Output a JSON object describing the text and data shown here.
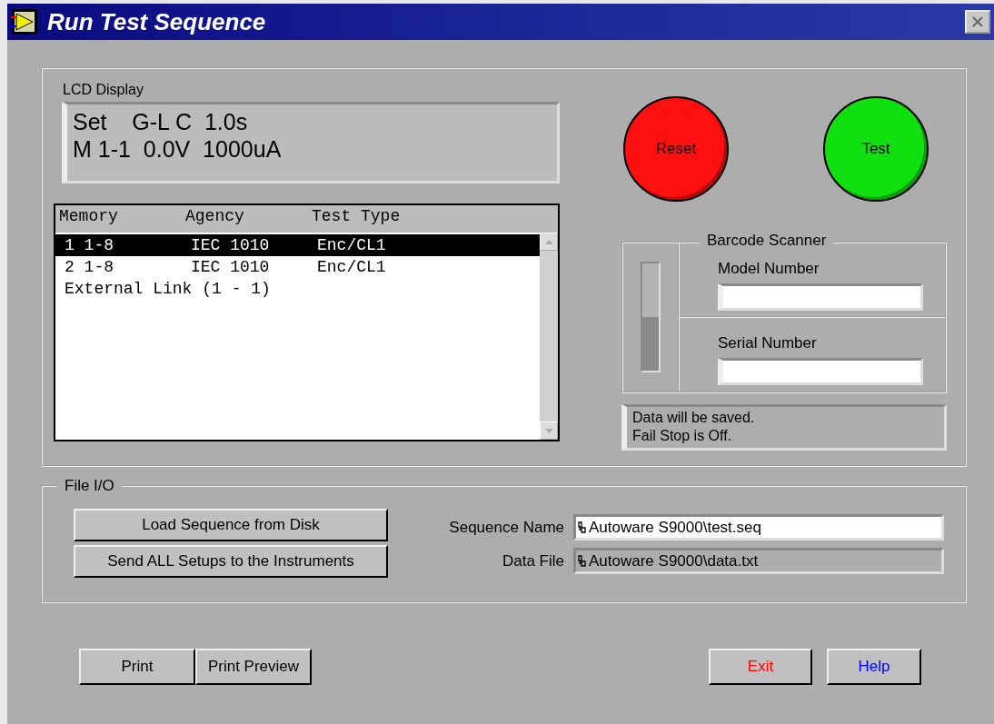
{
  "window": {
    "title": "Run Test Sequence"
  },
  "lcd_display": {
    "label": "LCD Display",
    "lines": [
      "Set    G-L C  1.0s",
      "M 1-1  0.0V  1000uA"
    ]
  },
  "sequence_list": {
    "columns": [
      "Memory",
      "Agency",
      "Test Type"
    ],
    "rows": [
      {
        "cells": [
          "1 1-8",
          "IEC 1010",
          "Enc/CL1"
        ],
        "selected": true
      },
      {
        "cells": [
          "2 1-8",
          "IEC 1010",
          "Enc/CL1"
        ],
        "selected": false
      },
      {
        "cells": [
          "External Link (1 - 1)"
        ],
        "selected": false
      }
    ]
  },
  "round_buttons": [
    {
      "label": "Reset",
      "color": "#ff1010"
    },
    {
      "label": "Test",
      "color": "#10e010"
    }
  ],
  "barcode_scanner": {
    "title": "Barcode Scanner",
    "level": 0.5,
    "fields": [
      {
        "label": "Model Number"
      },
      {
        "label": "Serial Number"
      }
    ]
  },
  "status_messages": [
    "Data will be saved.",
    "Fail Stop is Off."
  ],
  "file_io": {
    "title": "File I/O",
    "buttons": [
      "Load Sequence from Disk",
      "Send ALL Setups to the Instruments"
    ],
    "paths": [
      {
        "label": "Sequence Name",
        "value": "Autoware S9000\\test.seq",
        "disabled": false
      },
      {
        "label": "Data File",
        "value": "Autoware S9000\\data.txt",
        "disabled": true
      }
    ]
  },
  "footer_buttons": [
    {
      "label": "Print",
      "color": "#000000"
    },
    {
      "label": "Print Preview",
      "color": "#000000"
    },
    {
      "label": "Exit",
      "color": "#ff0000"
    },
    {
      "label": "Help",
      "color": "#0000ff"
    }
  ]
}
